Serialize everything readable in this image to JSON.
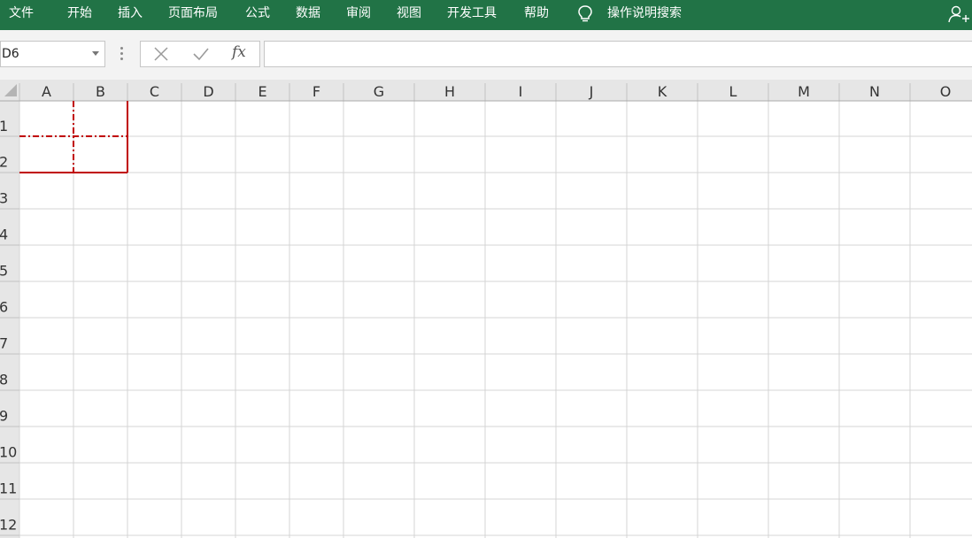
{
  "ribbon": {
    "tabs": [
      "文件",
      "开始",
      "插入",
      "页面布局",
      "公式",
      "数据",
      "审阅",
      "视图",
      "开发工具",
      "帮助"
    ],
    "tell_me": "操作说明搜索"
  },
  "formula_bar": {
    "name_box": "D6",
    "fx_label": "fx",
    "formula_value": ""
  },
  "sheet": {
    "columns": [
      "A",
      "B",
      "C",
      "D",
      "E",
      "F",
      "G",
      "H",
      "I",
      "J",
      "K",
      "L",
      "M",
      "N",
      "O"
    ],
    "rows": [
      "1",
      "2",
      "3",
      "4",
      "5",
      "6",
      "7",
      "8",
      "9",
      "10",
      "11",
      "12"
    ],
    "border_color": "#c00000"
  },
  "colors": {
    "ribbon": "#217346",
    "header_bg": "#e6e6e6",
    "gridline": "#d4d4d4"
  }
}
